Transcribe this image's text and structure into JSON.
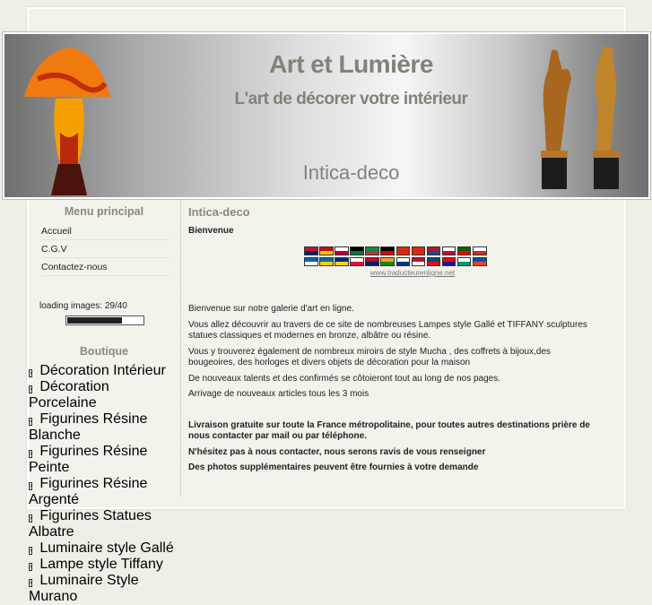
{
  "header": {
    "title": "Art et Lumière",
    "subtitle": "L'art de décorer votre intérieur",
    "site_name": "Intica-deco"
  },
  "sidebar": {
    "menu_title": "Menu principal",
    "menu_items": [
      "Accueil",
      "C.G.V",
      "Contactez-nous"
    ],
    "loading_text": "loading images: 29/40",
    "loading_progress": 0.725,
    "shop_title": "Boutique",
    "shop_items": [
      "Décoration Intérieur",
      "Décoration Porcelaine",
      "Figurines Résine Blanche",
      "Figurines Résine Peinte",
      "Figurines Résine Argenté",
      "Figurines Statues Albatre",
      "Luminaire style Gallé",
      "Lampe style Tiffany",
      "Luminaire Style Murano"
    ]
  },
  "main": {
    "title": "Intica-deco",
    "welcome": "Bienvenue",
    "flags": [
      [
        "#c8102e",
        "#012169"
      ],
      [
        "#c60b1e",
        "#ffc400"
      ],
      [
        "#ffffff",
        "#bc002d"
      ],
      [
        "#000000",
        "#007a3d"
      ],
      [
        "#009246",
        "#ce2b37"
      ],
      [
        "#000000",
        "#dd0000"
      ],
      [
        "#de2910",
        "#de2910"
      ],
      [
        "#de2910",
        "#de2910"
      ],
      [
        "#ae1c28",
        "#21468b"
      ],
      [
        "#ffffff",
        "#c60c30"
      ],
      [
        "#006600",
        "#ff0000"
      ],
      [
        "#ffffff",
        "#d52b1e"
      ],
      [
        "#0d5eaf",
        "#ffffff"
      ],
      [
        "#006aa7",
        "#fecc00"
      ],
      [
        "#002b7f",
        "#fcd116"
      ],
      [
        "#ffffff",
        "#dc143c"
      ],
      [
        "#ba0c2f",
        "#00205b"
      ],
      [
        "#ff9933",
        "#138808"
      ],
      [
        "#ffffff",
        "#003580"
      ],
      [
        "#c60c30",
        "#ffffff"
      ],
      [
        "#11457e",
        "#d7141a"
      ],
      [
        "#ff0000",
        "#171796"
      ],
      [
        "#ffffff",
        "#00966e"
      ],
      [
        "#0055a4",
        "#ef4135"
      ]
    ],
    "translator_link": "www.traducteurenligne.net",
    "paragraphs": [
      "Bienvenue sur notre galerie d'art en ligne.",
      "Vous allez découvrir au travers de ce site de nombreuses Lampes style Gallé et TIFFANY  sculptures statues classiques et modernes en bronze, albâtre ou résine.",
      "Vous y trouverez également de nombreux miroirs  de style  Mucha , des coffrets à bijoux,des bougeoires, des horloges  et divers objets de décoration pour la maison",
      "De nouveaux talents et des confirmés se côtoieront tout au long de nos pages.",
      "Arrivage de nouveaux articles tous les 3 mois"
    ],
    "bold_paragraphs": [
      "Livraison gratuite sur toute la France métropolitaine, pour toutes autres destinations prière de nous contacter par mail ou par téléphone.",
      "N'hésitez pas à nous contacter, nous serons ravis de vous renseigner",
      "Des photos supplémentaires peuvent être fournies à votre demande"
    ]
  }
}
